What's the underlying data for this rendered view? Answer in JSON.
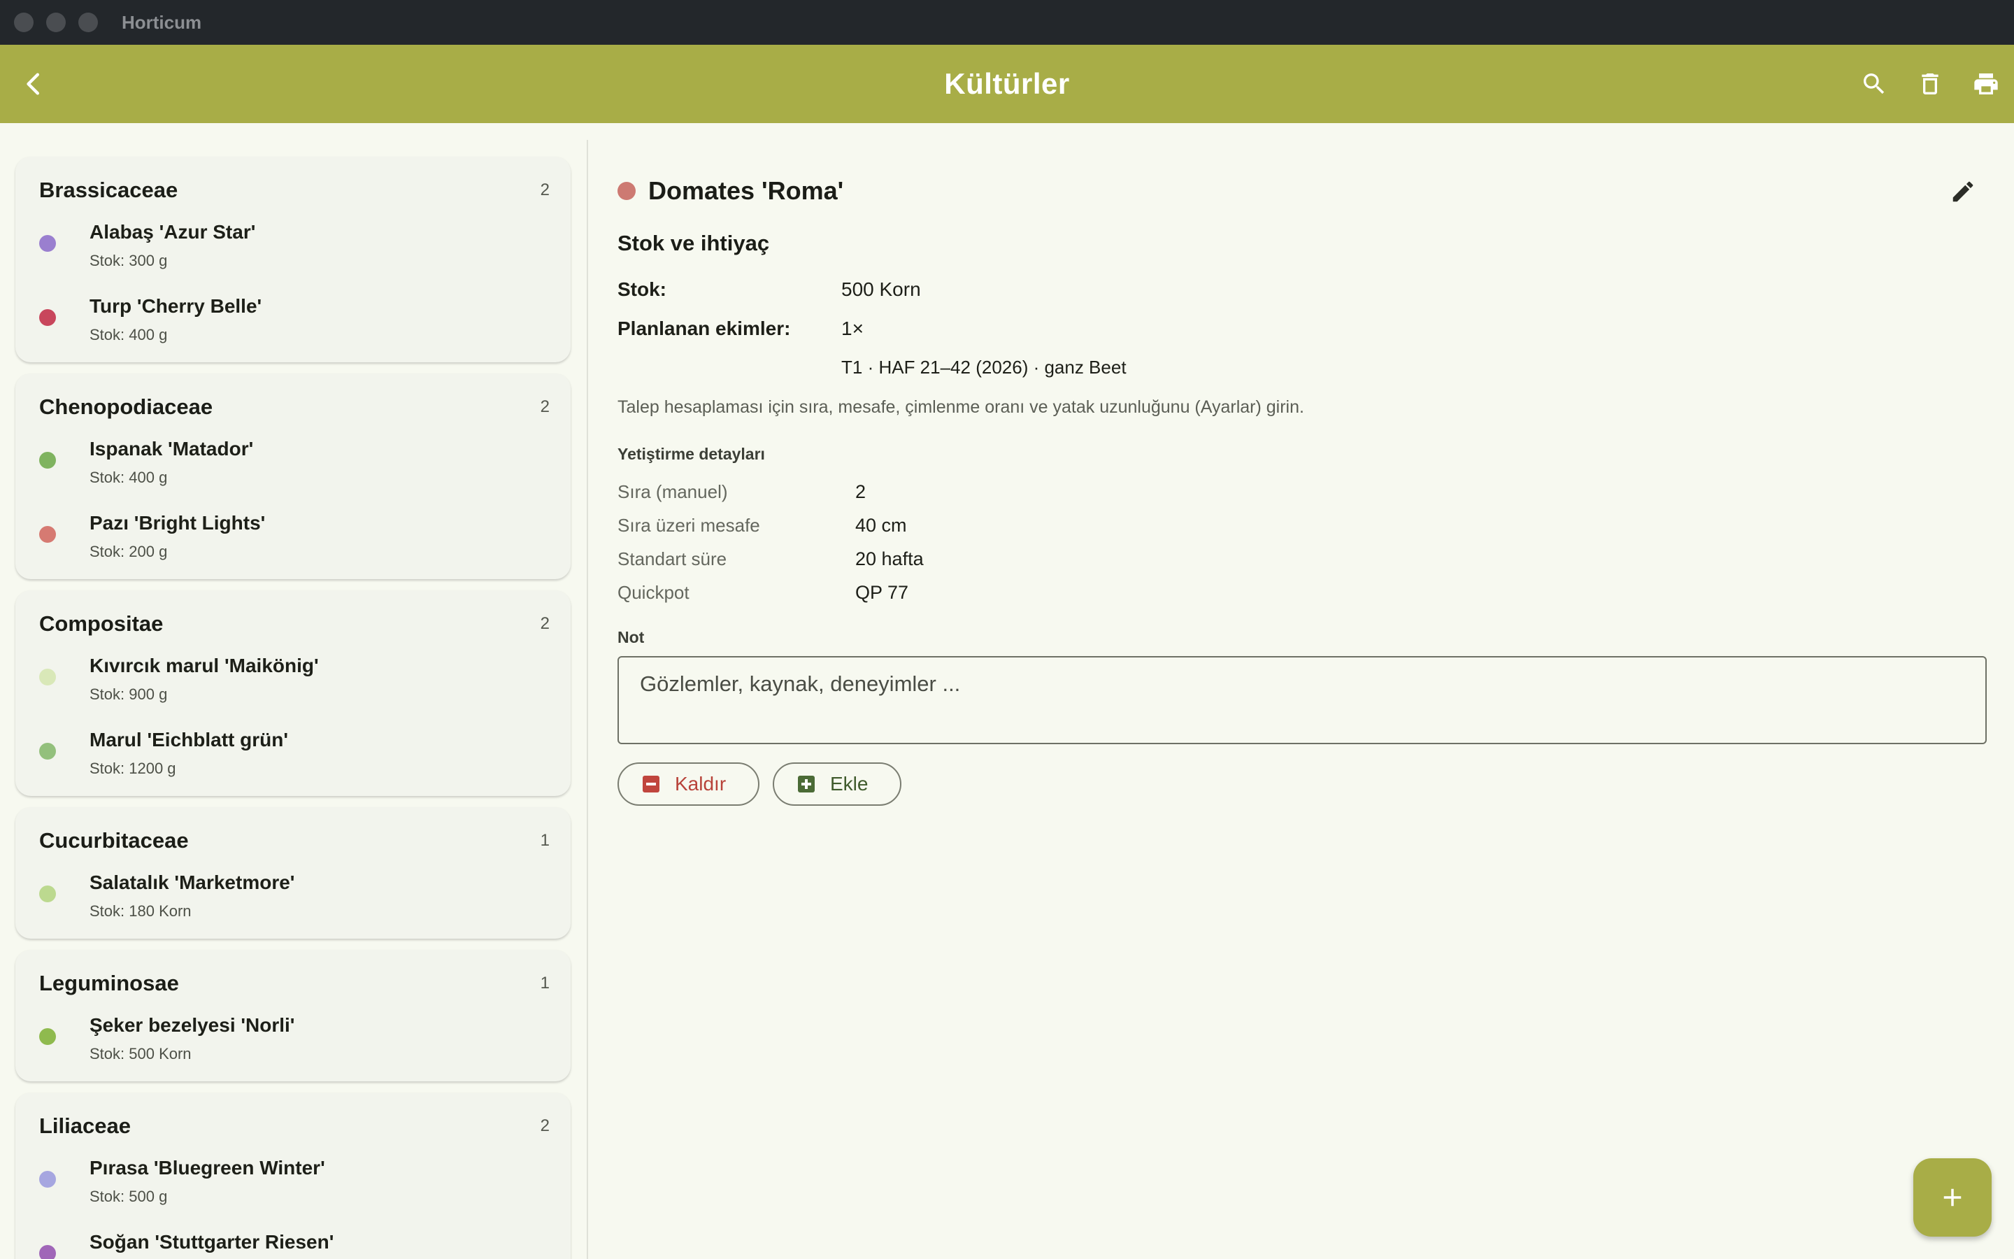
{
  "window": {
    "title": "Horticum"
  },
  "appbar": {
    "title": "Kültürler"
  },
  "colors": {
    "accent": "#a8ad47",
    "titlebar": "#23272b",
    "background": "#f7f9f0"
  },
  "groups": [
    {
      "name": "Brassicaceae",
      "count": "2",
      "items": [
        {
          "name": "Alabaş 'Azur Star'",
          "stock": "Stok: 300 g",
          "color": "#9a7fcf"
        },
        {
          "name": "Turp 'Cherry Belle'",
          "stock": "Stok: 400 g",
          "color": "#c8465c"
        }
      ]
    },
    {
      "name": "Chenopodiaceae",
      "count": "2",
      "items": [
        {
          "name": "Ispanak 'Matador'",
          "stock": "Stok: 400 g",
          "color": "#7fb35f"
        },
        {
          "name": "Pazı 'Bright Lights'",
          "stock": "Stok: 200 g",
          "color": "#d67a72"
        }
      ]
    },
    {
      "name": "Compositae",
      "count": "2",
      "items": [
        {
          "name": "Kıvırcık marul 'Maikönig'",
          "stock": "Stok: 900 g",
          "color": "#d9e8b8"
        },
        {
          "name": "Marul 'Eichblatt grün'",
          "stock": "Stok: 1200 g",
          "color": "#93c07c"
        }
      ]
    },
    {
      "name": "Cucurbitaceae",
      "count": "1",
      "items": [
        {
          "name": "Salatalık 'Marketmore'",
          "stock": "Stok: 180 Korn",
          "color": "#bcd98f"
        }
      ]
    },
    {
      "name": "Leguminosae",
      "count": "1",
      "items": [
        {
          "name": "Şeker bezelyesi 'Norli'",
          "stock": "Stok: 500 Korn",
          "color": "#8fba4e"
        }
      ]
    },
    {
      "name": "Liliaceae",
      "count": "2",
      "items": [
        {
          "name": "Pırasa 'Bluegreen Winter'",
          "stock": "Stok: 500 g",
          "color": "#a6a6e0"
        },
        {
          "name": "Soğan 'Stuttgarter Riesen'",
          "stock": "",
          "color": "#a066b8"
        }
      ]
    }
  ],
  "detail": {
    "title": "Domates 'Roma'",
    "color": "#cd7a72",
    "section_title": "Stok ve ihtiyaç",
    "stock_label": "Stok:",
    "stock_value": "500 Korn",
    "planned_label": "Planlanan ekimler:",
    "planned_value": "1×",
    "planned_detail": "T1 · HAF 21–42 (2026) · ganz Beet",
    "hint": "Talep hesaplaması için sıra, mesafe, çimlenme oranı ve yatak uzunluğunu (Ayarlar) girin.",
    "growing_title": "Yetiştirme detayları",
    "growing": [
      {
        "label": "Sıra (manuel)",
        "value": "2"
      },
      {
        "label": "Sıra üzeri mesafe",
        "value": "40 cm"
      },
      {
        "label": "Standart süre",
        "value": "20 hafta"
      },
      {
        "label": "Quickpot",
        "value": "QP 77"
      }
    ],
    "note_label": "Not",
    "note_placeholder": "Gözlemler, kaynak, deneyimler ...",
    "remove_label": "Kaldır",
    "add_label": "Ekle"
  }
}
